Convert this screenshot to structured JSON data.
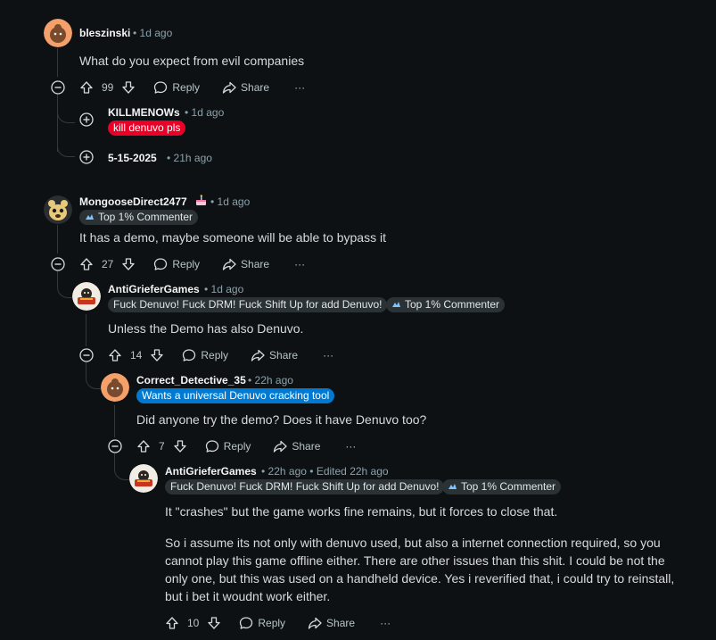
{
  "comments": [
    {
      "username": "bleszinski",
      "time": "1d ago",
      "body": "What do you expect from evil companies",
      "votes": "99",
      "reply_label": "Reply",
      "share_label": "Share",
      "more_label": "···",
      "replies": [
        {
          "username": "KILLMENOWs",
          "time": "1d ago",
          "flair": "kill denuvo pls"
        },
        {
          "username": "5-15-2025",
          "time": "21h ago"
        }
      ]
    },
    {
      "username": "MongooseDirect2477",
      "time": "1d ago",
      "badge": "Top 1% Commenter",
      "body": "It has a demo, maybe someone will be able to bypass it",
      "votes": "27",
      "reply_label": "Reply",
      "share_label": "Share",
      "more_label": "···"
    },
    {
      "username": "AntiGrieferGames",
      "time": "1d ago",
      "flair": "Fuck Denuvo! Fuck DRM! Fuck Shift Up for add Denuvo!",
      "badge": "Top 1% Commenter",
      "body": "Unless the Demo has also Denuvo.",
      "votes": "14",
      "reply_label": "Reply",
      "share_label": "Share",
      "more_label": "···"
    },
    {
      "username": "Correct_Detective_35",
      "time": "22h ago",
      "flair": "Wants a universal Denuvo cracking tool",
      "body": "Did anyone try the demo? Does it have Denuvo too?",
      "votes": "7",
      "reply_label": "Reply",
      "share_label": "Share",
      "more_label": "···"
    },
    {
      "username": "AntiGrieferGames",
      "time": "22h ago",
      "edited": "Edited 22h ago",
      "flair": "Fuck Denuvo! Fuck DRM! Fuck Shift Up for add Denuvo!",
      "badge": "Top 1% Commenter",
      "body": [
        "It \"crashes\" but the game works fine remains, but it forces to close that.",
        "So i assume its not only with denuvo used, but also a internet connection required, so you",
        "cannot play this game offline either. There are other issues than this shit. I could be not the",
        "only one, but this was used on a handheld device. Yes i reverified that, i could try to reinstall,",
        "but i bet it woudnt work either."
      ],
      "votes": "10",
      "reply_label": "Reply",
      "share_label": "Share",
      "more_label": "···"
    }
  ],
  "separator": "•",
  "colors": {
    "background": "#0e1113",
    "flair_red": "#ea0027",
    "flair_blue": "#0079d3",
    "flair_dark": "#2a3236"
  },
  "icons": [
    "collapse-icon",
    "expand-icon",
    "upvote-icon",
    "downvote-icon",
    "reply-icon",
    "share-icon",
    "more-icon",
    "top-commenter-icon",
    "cake-icon"
  ]
}
